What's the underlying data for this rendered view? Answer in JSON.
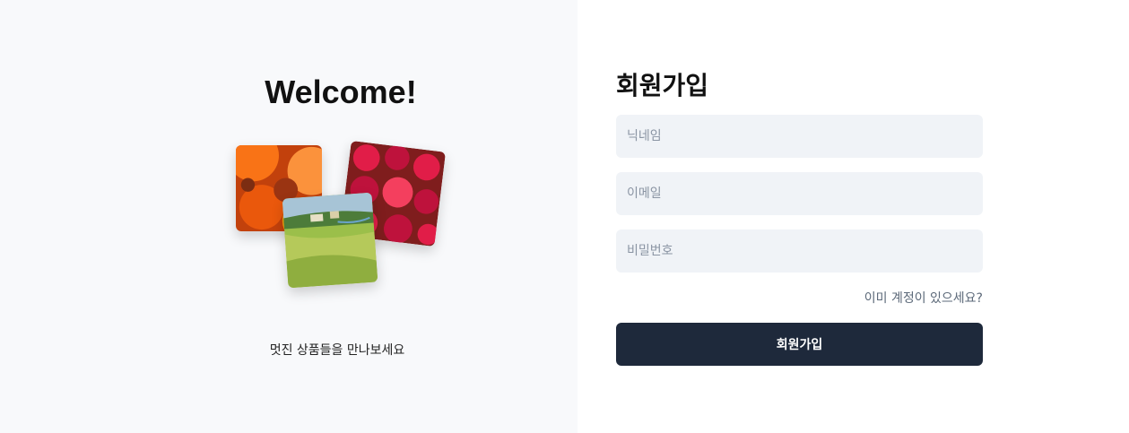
{
  "welcome": {
    "title": "Welcome!",
    "tagline": "멋진 상품들을 만나보세요"
  },
  "gallery": {
    "images": [
      "oranges-photo",
      "raspberries-photo",
      "landscape-painting"
    ]
  },
  "signup": {
    "title": "회원가입",
    "nickname_placeholder": "닉네임",
    "email_placeholder": "이메일",
    "password_placeholder": "비밀번호",
    "login_link": "이미 계정이 있으세요?",
    "submit_label": "회원가입"
  },
  "colors": {
    "left_background": "#f8f9fb",
    "input_background": "#f0f3f7",
    "button_background": "#1e293b",
    "button_text": "#ffffff",
    "link_text": "#5b6878"
  }
}
